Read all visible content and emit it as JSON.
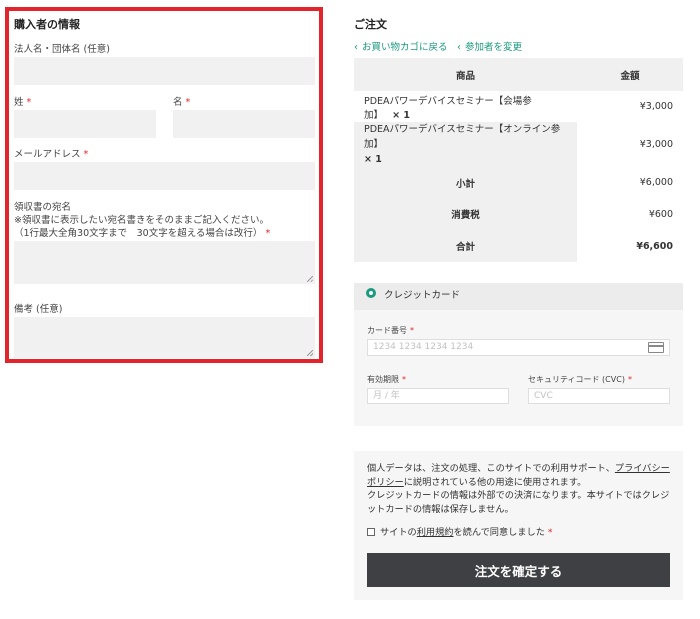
{
  "billing": {
    "title": "購入者の情報",
    "company_label": "法人名・団体名 (任意)",
    "last_name_label": "姓",
    "first_name_label": "名",
    "email_label": "メールアドレス",
    "receipt_label_line1": "領収書の宛名",
    "receipt_label_line2": "※領収書に表示したい宛名書きをそのままご記入ください。",
    "receipt_label_line3": "（1行最大全角30文字まで　30文字を超える場合は改行）",
    "notes_label": "備考 (任意)",
    "required_mark": "*"
  },
  "order": {
    "title": "ご注文",
    "back_to_cart": "お買い物カゴに戻る",
    "change_participant": "参加者を変更",
    "col_product": "商品",
    "col_amount": "金額",
    "items": [
      {
        "name": "PDEAパワーデバイスセミナー【会場参加】",
        "qty": "× 1",
        "price": "¥3,000"
      },
      {
        "name": "PDEAパワーデバイスセミナー【オンライン参加】",
        "qty": "× 1",
        "price": "¥3,000"
      }
    ],
    "subtotal_label": "小計",
    "subtotal_value": "¥6,000",
    "tax_label": "消費税",
    "tax_value": "¥600",
    "total_label": "合計",
    "total_value": "¥6,600"
  },
  "payment": {
    "method_label": "クレジットカード",
    "card_number_label": "カード番号",
    "card_number_placeholder": "1234 1234 1234 1234",
    "expiry_label": "有効期限",
    "expiry_placeholder": "月 / 年",
    "cvc_label": "セキュリティコード (CVC)",
    "cvc_placeholder": "CVC"
  },
  "privacy": {
    "text_before": "個人データは、注文の処理、このサイトでの利用サポート、",
    "policy_link": "プライバシーポリシー",
    "text_after": "に説明されている他の用途に使用されます。",
    "card_note": "クレジットカードの情報は外部での決済になります。本サイトではクレジットカードの情報は保存しません。"
  },
  "terms": {
    "prefix": "サイトの",
    "link": "利用規約",
    "suffix": "を読んで同意しました"
  },
  "submit_label": "注文を確定する",
  "colors": {
    "accent": "#1a9a7f",
    "highlight_border": "#e3242b",
    "button": "#3f4044"
  }
}
